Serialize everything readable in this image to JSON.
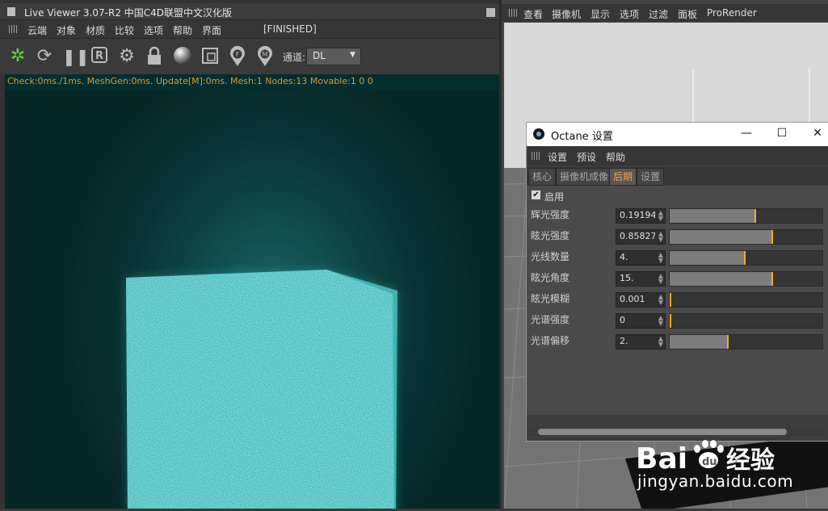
{
  "live_viewer": {
    "title": "Live Viewer 3.07-R2 中国C4D联盟中文汉化版",
    "status": "[FINISHED]",
    "menu": [
      "云端",
      "对象",
      "材质",
      "比较",
      "选项",
      "帮助",
      "界面"
    ],
    "toolbar": {
      "icons": [
        "octane-logo-icon",
        "refresh-icon",
        "pause-icon",
        "render-region-icon",
        "gear-icon",
        "lock-icon",
        "sphere-icon",
        "frame-icon",
        "focus-picker-icon",
        "material-picker-icon"
      ],
      "channel_label": "通道:",
      "channel_value": "DL"
    },
    "stats": "Check:0ms./1ms. MeshGen:0ms. Update[M]:0ms. Mesh:1 Nodes:13 Movable:1  0 0"
  },
  "viewport": {
    "menu": [
      "查看",
      "摄像机",
      "显示",
      "选项",
      "过滤",
      "面板",
      "ProRender"
    ]
  },
  "octane_settings": {
    "title": "Octane 设置",
    "window_buttons": [
      "—",
      "☐",
      "✕"
    ],
    "menu": [
      "设置",
      "预设",
      "帮助"
    ],
    "tabs": [
      {
        "label": "核心",
        "active": false
      },
      {
        "label": "摄像机成像",
        "active": false
      },
      {
        "label": "后期",
        "active": true
      },
      {
        "label": "设置",
        "active": false
      }
    ],
    "enable_label": "启用",
    "enable_checked": true,
    "params": [
      {
        "label": "辉光强度",
        "value": "0.191949",
        "level": 0.56
      },
      {
        "label": "眩光强度",
        "value": "0.858279",
        "level": 0.67
      },
      {
        "label": "光线数量",
        "value": "4.",
        "level": 0.49
      },
      {
        "label": "眩光角度",
        "value": "15.",
        "level": 0.67
      },
      {
        "label": "眩光模糊",
        "value": "0.001",
        "level": 0.0
      },
      {
        "label": "光谱强度",
        "value": "0",
        "level": 0.0
      },
      {
        "label": "光谱偏移",
        "value": "2.",
        "level": 0.38
      }
    ]
  },
  "watermark": {
    "logo": "Bai du 经验",
    "url": "jingyan.baidu.com"
  }
}
